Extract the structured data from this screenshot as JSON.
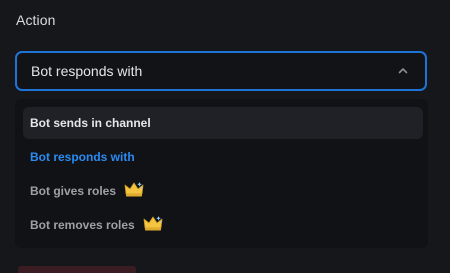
{
  "section": {
    "label": "Action"
  },
  "select": {
    "value": "Bot responds with"
  },
  "menu": {
    "options": [
      {
        "label": "Bot sends in channel",
        "state": "hovered",
        "premium": false
      },
      {
        "label": "Bot responds with",
        "state": "selected",
        "premium": false
      },
      {
        "label": "Bot gives roles",
        "state": "normal",
        "premium": true
      },
      {
        "label": "Bot removes roles",
        "state": "normal",
        "premium": true
      }
    ]
  },
  "colors": {
    "accent": "#1f73d6",
    "selected_text": "#2a8bf2",
    "background": "#16171b",
    "crown_gold": "#f5c542"
  },
  "icons": {
    "select_toggle": "chevron-up-icon",
    "premium": "crown-icon"
  }
}
